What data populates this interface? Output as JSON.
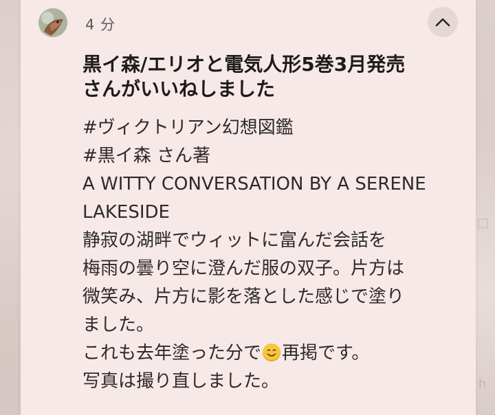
{
  "post": {
    "time": "4 分",
    "headline_line1": "黒イ森/エリオと電気人形5巻3月発売",
    "headline_line2": "さんがいいねしました",
    "tags": [
      "#ヴィクトリアン幻想図鑑",
      "#黒イ森 さん著"
    ],
    "english_title_line1": "A WITTY CONVERSATION BY A SERENE",
    "english_title_line2": "LAKESIDE",
    "lines": [
      "静寂の湖畔でウィットに富んだ会話を",
      "梅雨の曇り空に澄んだ服の双子。片方は",
      "微笑み、片方に影を落とした感じで塗り",
      "ました。"
    ],
    "line_with_emoji_before": "これも去年塗った分で",
    "emoji": "smiling-face",
    "line_with_emoji_after": "再掲です。",
    "last_line": "写真は撮り直しました。"
  },
  "icons": {
    "collapse": "chevron-up-icon",
    "avatar": "user-avatar"
  }
}
